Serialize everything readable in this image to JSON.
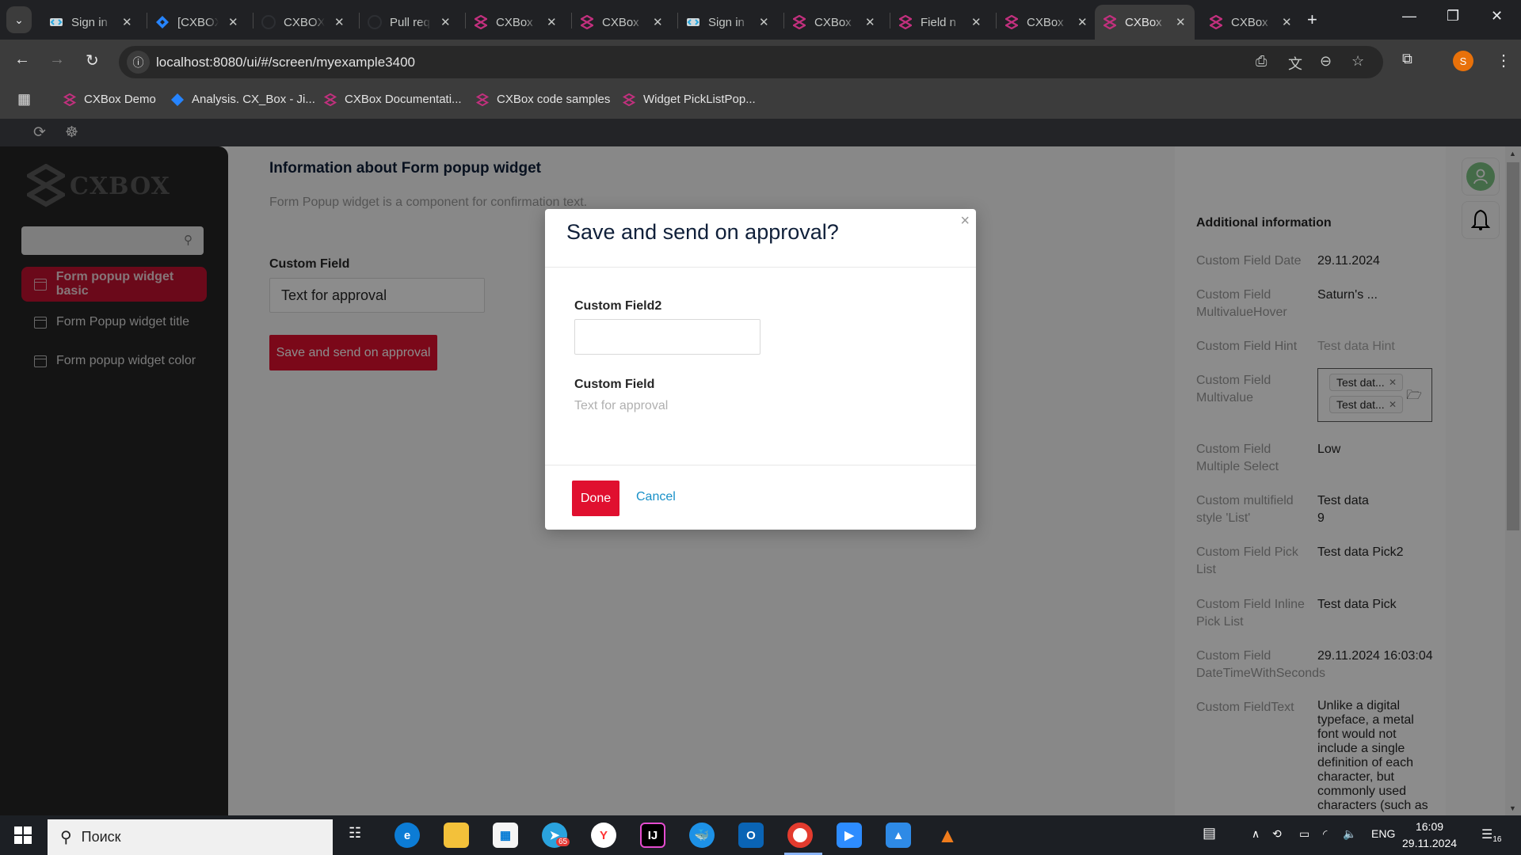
{
  "browser": {
    "tabs": [
      {
        "title": "Sign in",
        "icon": "keycloak-icon"
      },
      {
        "title": "[CXBOX",
        "icon": "jira-icon"
      },
      {
        "title": "CXBOX",
        "icon": "github-icon"
      },
      {
        "title": "Pull req",
        "icon": "github-icon"
      },
      {
        "title": "CXBox",
        "icon": "cxbox-icon"
      },
      {
        "title": "CXBox",
        "icon": "cxbox-icon"
      },
      {
        "title": "Sign in",
        "icon": "keycloak-icon"
      },
      {
        "title": "CXBox",
        "icon": "cxbox-icon"
      },
      {
        "title": "Field n",
        "icon": "cxbox-icon"
      },
      {
        "title": "CXBox",
        "icon": "cxbox-icon"
      },
      {
        "title": "CXBox",
        "icon": "cxbox-icon",
        "active": true
      },
      {
        "title": "CXBox",
        "icon": "cxbox-icon"
      }
    ],
    "new_tab": "+",
    "url": "localhost:8080/ui/#/screen/myexample3400",
    "profile_initial": "S",
    "bookmarks": [
      {
        "label": "CXBox Demo",
        "icon": "cxbox-icon"
      },
      {
        "label": "Analysis. CX_Box - Ji...",
        "icon": "jira-icon"
      },
      {
        "label": "CXBox Documentati...",
        "icon": "cxbox-icon"
      },
      {
        "label": "CXBox code samples",
        "icon": "cxbox-icon"
      },
      {
        "label": "Widget PickListPop...",
        "icon": "cxbox-icon"
      }
    ]
  },
  "sidebar": {
    "logo_text": "CXBOX",
    "search_placeholder": "",
    "items": [
      {
        "label": "Form popup widget basic",
        "active": true
      },
      {
        "label": "Form Popup widget title",
        "active": false
      },
      {
        "label": "Form popup widget color",
        "active": false
      }
    ]
  },
  "main": {
    "title": "Information about Form popup widget",
    "description": "Form Popup widget is a component for confirmation text.",
    "custom_field_label": "Custom Field",
    "custom_field_value": "Text for approval",
    "save_button": "Save and send on approval"
  },
  "info_panel": {
    "title": "Additional information",
    "rows": [
      {
        "label": "Custom Field Date",
        "value": "29.11.2024"
      },
      {
        "label": "Custom Field MultivalueHover",
        "value": "Saturn's ..."
      },
      {
        "label": "Custom Field Hint",
        "value": "Test data Hint"
      },
      {
        "label": "Custom Field Multivalue",
        "tags": [
          "Test dat...",
          "Test dat..."
        ]
      },
      {
        "label": "Custom Field Multiple Select",
        "value": "Low"
      },
      {
        "label": "Custom multifield style 'List'",
        "value": "Test data",
        "value2": "9"
      },
      {
        "label": "Custom Field Pick List",
        "value": "Test data Pick2"
      },
      {
        "label": "Custom Field Inline Pick List",
        "value": "Test data Pick"
      },
      {
        "label": "Custom Field DateTimeWithSeconds",
        "value": "29.11.2024 16:03:04"
      },
      {
        "label": "Custom FieldText",
        "value": "Unlike a digital typeface, a metal font would not include a single definition of each character, but commonly used characters (such as"
      }
    ]
  },
  "modal": {
    "title": "Save and send on approval?",
    "field2_label": "Custom Field2",
    "field2_value": "",
    "field_label": "Custom Field",
    "field_value": "Text for approval",
    "done_button": "Done",
    "cancel_button": "Cancel",
    "close_symbol": "×"
  },
  "taskbar": {
    "search_placeholder": "Поиск",
    "language": "ENG",
    "time": "16:09",
    "date": "29.11.2024",
    "notification_count": "16",
    "telegram_badge": "65"
  },
  "colors": {
    "accent": "#e0102f",
    "link": "#1890c8",
    "sidebar_bg": "#252525"
  }
}
